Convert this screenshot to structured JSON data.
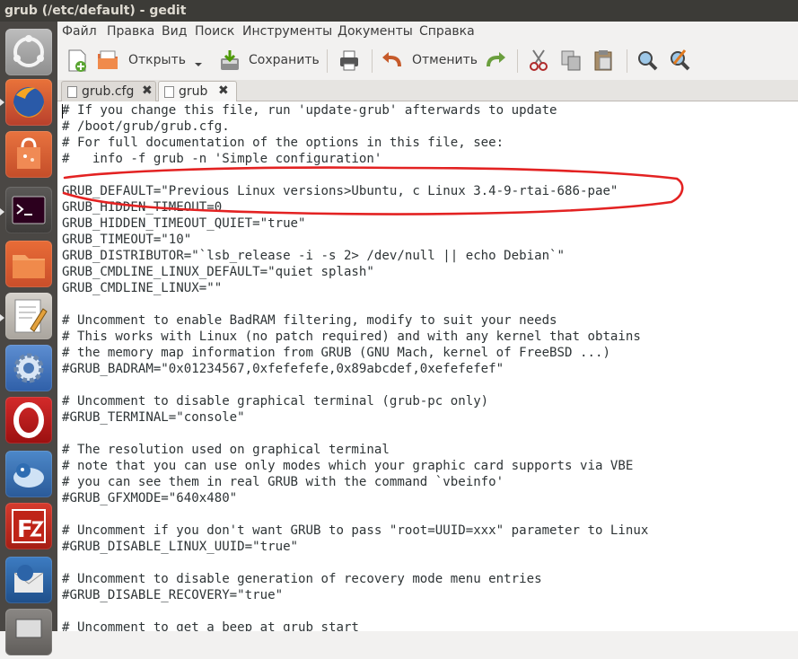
{
  "window": {
    "title": "grub (/etc/default) - gedit"
  },
  "menu": [
    "Файл",
    "Правка",
    "Вид",
    "Поиск",
    "Инструменты",
    "Документы",
    "Справка"
  ],
  "toolbar": {
    "new_icon": "new-document-icon",
    "open_label": "Открыть",
    "save_label": "Сохранить",
    "undo_label": "Отменить",
    "icons": [
      "new-document-icon",
      "open-folder-icon",
      "dropdown-arrow-icon",
      "save-icon",
      "print-icon",
      "undo-icon",
      "redo-icon",
      "cut-icon",
      "copy-icon",
      "paste-icon",
      "search-icon",
      "replace-icon"
    ]
  },
  "tabs": [
    {
      "label": "grub.cfg",
      "active": false
    },
    {
      "label": "grub",
      "active": true
    }
  ],
  "launcher": [
    "ubuntu-dash-icon",
    "firefox-icon",
    "software-center-icon",
    "terminal-icon",
    "files-icon",
    "text-editor-icon",
    "system-settings-icon",
    "opera-icon",
    "thunderbird-like-icon",
    "filezilla-icon",
    "thunderbird-icon",
    "desktop-icon"
  ],
  "highlight_color": "#e32222",
  "editor": {
    "lines": [
      "# If you change this file, run 'update-grub' afterwards to update",
      "# /boot/grub/grub.cfg.",
      "# For full documentation of the options in this file, see:",
      "#   info -f grub -n 'Simple configuration'",
      "",
      "GRUB_DEFAULT=\"Previous Linux versions>Ubuntu, с Linux 3.4-9-rtai-686-pae\"",
      "GRUB_HIDDEN_TIMEOUT=0",
      "GRUB_HIDDEN_TIMEOUT_QUIET=\"true\"",
      "GRUB_TIMEOUT=\"10\"",
      "GRUB_DISTRIBUTOR=\"`lsb_release -i -s 2> /dev/null || echo Debian`\"",
      "GRUB_CMDLINE_LINUX_DEFAULT=\"quiet splash\"",
      "GRUB_CMDLINE_LINUX=\"\"",
      "",
      "# Uncomment to enable BadRAM filtering, modify to suit your needs",
      "# This works with Linux (no patch required) and with any kernel that obtains",
      "# the memory map information from GRUB (GNU Mach, kernel of FreeBSD ...)",
      "#GRUB_BADRAM=\"0x01234567,0xfefefefe,0x89abcdef,0xefefefef\"",
      "",
      "# Uncomment to disable graphical terminal (grub-pc only)",
      "#GRUB_TERMINAL=\"console\"",
      "",
      "# The resolution used on graphical terminal",
      "# note that you can use only modes which your graphic card supports via VBE",
      "# you can see them in real GRUB with the command `vbeinfo'",
      "#GRUB_GFXMODE=\"640x480\"",
      "",
      "# Uncomment if you don't want GRUB to pass \"root=UUID=xxx\" parameter to Linux",
      "#GRUB_DISABLE_LINUX_UUID=\"true\"",
      "",
      "# Uncomment to disable generation of recovery mode menu entries",
      "#GRUB_DISABLE_RECOVERY=\"true\"",
      "",
      "# Uncomment to get a beep at grub start"
    ]
  }
}
